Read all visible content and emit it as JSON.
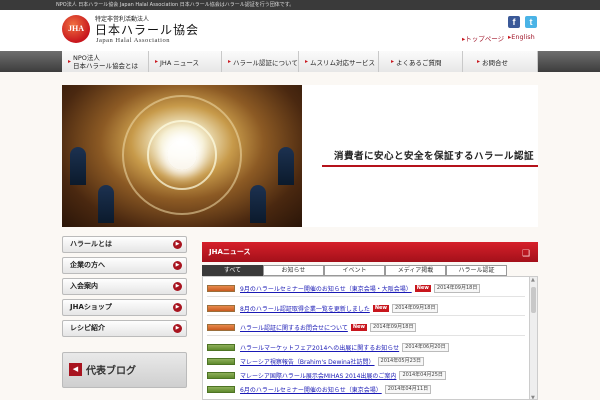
{
  "top_strip": {
    "text": "NPO法人 日本ハラール協会 Japan Halal Association 日本ハラール協会はハラール認証を行う団体です。"
  },
  "header": {
    "logo_mark": "JHA",
    "logo_small": "特定非営利活動法人",
    "logo_big": "日本ハラール協会",
    "logo_en": "Japan Halal Association",
    "top_page_link": "トップページ",
    "english_link": "English",
    "social_facebook": "f",
    "social_twitter": "t"
  },
  "nav": {
    "items": [
      {
        "label_1": "NPO法人",
        "label_2": "日本ハラール協会とは"
      },
      {
        "label": "JHA ニュース"
      },
      {
        "label": "ハラール認証について"
      },
      {
        "label": "ムスリム対応サービス"
      },
      {
        "label": "よくあるご質問"
      },
      {
        "label": "お問合せ"
      }
    ]
  },
  "hero": {
    "tagline": "消費者に安心と安全を保証するハラール認証"
  },
  "sidebar": {
    "items": [
      {
        "label": "ハラールとは"
      },
      {
        "label": "企業の方へ"
      },
      {
        "label": "入会案内"
      },
      {
        "label": "JHAショップ"
      },
      {
        "label": "レシピ紹介"
      }
    ],
    "blog_label": "代表ブログ"
  },
  "news": {
    "heading": "JHAニュース",
    "tabs": [
      "すべて",
      "お知らせ",
      "イベント",
      "メディア掲載",
      "ハラール認証"
    ],
    "active_tab": 0,
    "items": [
      {
        "category": "red",
        "title": "9月のハラールセミナー開催のお知らせ（東京会場・大阪会場）",
        "new": "New",
        "date": "2014年09月18日"
      },
      {
        "category": "red",
        "title": "8月のハラール認証取得企業一覧を更新しました",
        "new": "New",
        "date": "2014年09月18日"
      },
      {
        "category": "red",
        "title": "ハラール認証に関するお問合せについて",
        "new": "New",
        "date": "2014年09月18日"
      },
      {
        "category": "green",
        "title": "ハラールマーケットフェア2014への出展に関するお知らせ",
        "new": "",
        "date": "2014年06月20日"
      },
      {
        "category": "green",
        "title": "マレーシア視察報告（Brahim's Dewina社訪問）",
        "new": "",
        "date": "2014年05月23日"
      },
      {
        "category": "green",
        "title": "マレーシア国際ハラール展示会MIHAS 2014出展のご案内",
        "new": "",
        "date": "2014年04月25日"
      },
      {
        "category": "green",
        "title": "6月のハラールセミナー開催のお知らせ（東京会場）",
        "new": "",
        "date": "2014年04月11日"
      }
    ]
  },
  "colors": {
    "accent": "#c8161d",
    "nav_bg": "#4a4a4a",
    "link": "#1a1ab5"
  }
}
